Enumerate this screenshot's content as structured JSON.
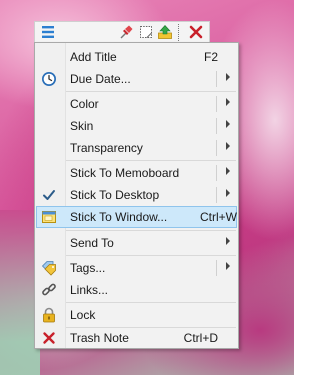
{
  "toolbar": {
    "buttons": [
      {
        "icon": "menu-lines-icon"
      },
      {
        "icon": "pushpin-icon"
      },
      {
        "icon": "note-outline-icon"
      },
      {
        "icon": "arrow-up-icon"
      },
      {
        "icon": "close-x-icon"
      }
    ]
  },
  "menu": {
    "items": [
      {
        "label": "Add Title",
        "shortcut": "F2"
      },
      {
        "label": "Due Date...",
        "icon": "clock-icon"
      },
      {
        "label": "Color"
      },
      {
        "label": "Skin"
      },
      {
        "label": "Transparency"
      },
      {
        "label": "Stick To Memoboard"
      },
      {
        "label": "Stick To Desktop",
        "icon": "checkmark-icon"
      },
      {
        "label": "Stick To Window...",
        "shortcut": "Ctrl+W",
        "icon": "window-icon"
      },
      {
        "label": "Send To"
      },
      {
        "label": "Tags...",
        "icon": "tags-icon"
      },
      {
        "label": "Links...",
        "icon": "chain-link-icon"
      },
      {
        "label": "Lock",
        "icon": "padlock-icon"
      },
      {
        "label": "Trash Note",
        "shortcut": "Ctrl+D",
        "icon": "trash-x-icon"
      }
    ]
  },
  "colors": {
    "highlight": "#cde8fa",
    "highlight_border": "#8fc4ec",
    "menu_bg": "#f2f2f2",
    "red_x": "#c8202a",
    "accent_blue": "#1f76c8"
  }
}
